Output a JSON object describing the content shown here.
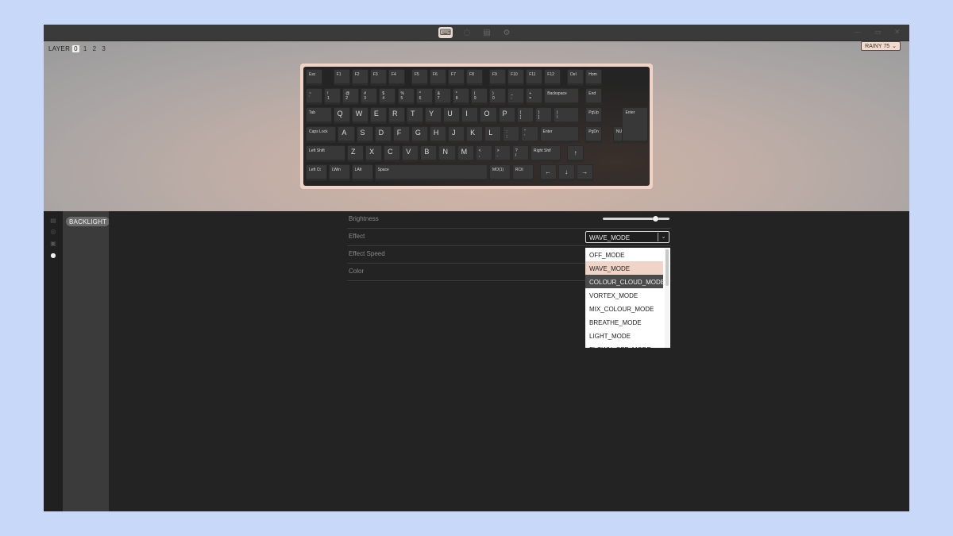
{
  "toolbar": {
    "tabs": [
      {
        "name": "keyboard-icon",
        "glyph": "⌨",
        "active": true
      },
      {
        "name": "lightbulb-icon",
        "glyph": "◌",
        "active": false
      },
      {
        "name": "remote-icon",
        "glyph": "▤",
        "active": false
      },
      {
        "name": "settings-icon",
        "glyph": "⚙",
        "active": false
      }
    ],
    "window_controls": {
      "minimize": "—",
      "maximize": "▭",
      "close": "✕"
    }
  },
  "layer": {
    "label": "LAYER",
    "options": [
      "0",
      "1",
      "2",
      "3"
    ],
    "active": "0"
  },
  "keyboard_model": {
    "label": "RAINY 75",
    "chevron": "⌄"
  },
  "keyboard": {
    "rows": [
      [
        "Esc",
        "F1",
        "F2",
        "F3",
        "F4",
        "F5",
        "F6",
        "F7",
        "F8",
        "F9",
        "F10",
        "F11",
        "F12",
        "Del",
        "Hom"
      ],
      [
        "~\n`",
        "!\n1",
        "@\n2",
        "#\n3",
        "$\n4",
        "%\n5",
        "^\n6",
        "&\n7",
        "*\n8",
        "(\n9",
        ")\n0",
        "_\n-",
        "+\n=",
        "Backspace",
        "End"
      ],
      [
        "Tab",
        "Q",
        "W",
        "E",
        "R",
        "T",
        "Y",
        "U",
        "I",
        "O",
        "P",
        "{\n[",
        "}\n]",
        "|\n\\",
        "PgUp"
      ],
      [
        "Caps Lock",
        "A",
        "S",
        "D",
        "F",
        "G",
        "H",
        "J",
        "K",
        "L",
        ":\n;",
        "\"\n'",
        "Enter",
        "PgDn",
        "NUH"
      ],
      [
        "Left Shift",
        "Z",
        "X",
        "C",
        "V",
        "B",
        "N",
        "M",
        "<\n,",
        ">\n.",
        "?\n/",
        "Right Shif",
        "↑"
      ],
      [
        "Left Ct",
        "LWin",
        "LAlt",
        "Space",
        "MO(1)",
        "RCtl",
        "←",
        "↓",
        "→"
      ]
    ],
    "iso_enter": "Enter"
  },
  "sidebar": {
    "icons": [
      "keymap-icon",
      "layout-icon",
      "save-icon",
      "lighting-icon"
    ],
    "menu": {
      "item": "BACKLIGHT"
    }
  },
  "settings": {
    "brightness": {
      "label": "Brightness",
      "value": 0.78
    },
    "effect": {
      "label": "Effect",
      "value": "WAVE_MODE"
    },
    "effect_speed": {
      "label": "Effect Speed"
    },
    "color": {
      "label": "Color"
    }
  },
  "dropdown": {
    "options": [
      "OFF_MODE",
      "WAVE_MODE",
      "COLOUR_CLOUD_MODE",
      "VORTEX_MODE",
      "MIX_COLOUR_MODE",
      "BREATHE_MODE",
      "LIGHT_MODE",
      "FLOWN_OFF_MODE"
    ],
    "selected": "WAVE_MODE",
    "hover": "COLOUR_CLOUD_MODE"
  }
}
